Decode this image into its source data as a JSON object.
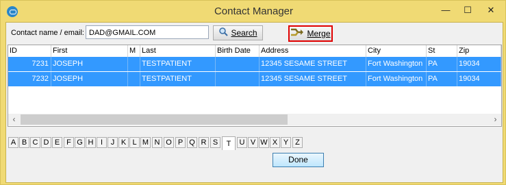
{
  "window": {
    "title": "Contact Manager",
    "minimize": "—",
    "maximize": "☐",
    "close": "✕"
  },
  "search": {
    "label": "Contact name / email:",
    "value": "DAD@GMAIL.COM",
    "button": "Search"
  },
  "merge": {
    "label": "Merge"
  },
  "grid": {
    "headers": [
      "ID",
      "First",
      "M",
      "Last",
      "Birth Date",
      "Address",
      "City",
      "St",
      "Zip"
    ],
    "rows": [
      {
        "id": "7231",
        "first": "JOSEPH",
        "m": "",
        "last": "TESTPATIENT",
        "birth": "",
        "address": "12345 SESAME STREET",
        "city": "Fort Washington",
        "st": "PA",
        "zip": "19034"
      },
      {
        "id": "7232",
        "first": "JOSEPH",
        "m": "",
        "last": "TESTPATIENT",
        "birth": "",
        "address": "12345 SESAME STREET",
        "city": "Fort Washington",
        "st": "PA",
        "zip": "19034"
      }
    ]
  },
  "alphabet": [
    "A",
    "B",
    "C",
    "D",
    "E",
    "F",
    "G",
    "H",
    "I",
    "J",
    "K",
    "L",
    "M",
    "N",
    "O",
    "P",
    "Q",
    "R",
    "S",
    "T",
    "U",
    "V",
    "W",
    "X",
    "Y",
    "Z"
  ],
  "active_letter": "T",
  "done": {
    "label": "Done"
  },
  "colors": {
    "selection": "#3399ff",
    "frame": "#f0da74",
    "merge_highlight": "#e00000"
  }
}
